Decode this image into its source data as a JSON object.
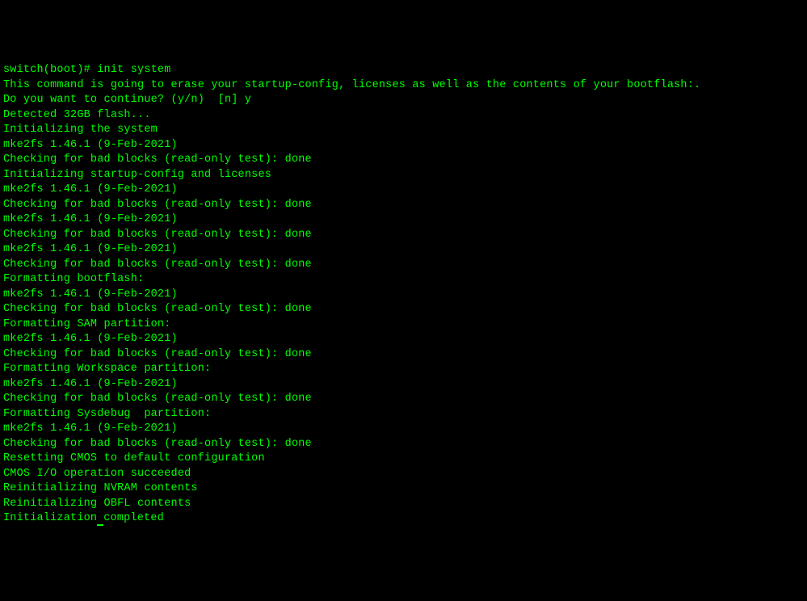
{
  "terminal": {
    "lines": [
      "switch(boot)# init system",
      "This command is going to erase your startup-config, licenses as well as the contents of your bootflash:.",
      "Do you want to continue? (y/n)  [n] y",
      "Detected 32GB flash...",
      "Initializing the system",
      "mke2fs 1.46.1 (9-Feb-2021)",
      "Checking for bad blocks (read-only test): done",
      "Initializing startup-config and licenses",
      "mke2fs 1.46.1 (9-Feb-2021)",
      "Checking for bad blocks (read-only test): done",
      "mke2fs 1.46.1 (9-Feb-2021)",
      "Checking for bad blocks (read-only test): done",
      "mke2fs 1.46.1 (9-Feb-2021)",
      "Checking for bad blocks (read-only test): done",
      "Formatting bootflash:",
      "mke2fs 1.46.1 (9-Feb-2021)",
      "Checking for bad blocks (read-only test): done",
      "Formatting SAM partition:",
      "mke2fs 1.46.1 (9-Feb-2021)",
      "Checking for bad blocks (read-only test): done",
      "Formatting Workspace partition:",
      "mke2fs 1.46.1 (9-Feb-2021)",
      "Checking for bad blocks (read-only test): done",
      "Formatting Sysdebug  partition:",
      "mke2fs 1.46.1 (9-Feb-2021)",
      "Checking for bad blocks (read-only test): done",
      "Resetting CMOS to default configuration",
      "CMOS I/O operation succeeded",
      "Reinitializing NVRAM contents",
      "Reinitializing OBFL contents",
      "Initialization completed"
    ]
  }
}
